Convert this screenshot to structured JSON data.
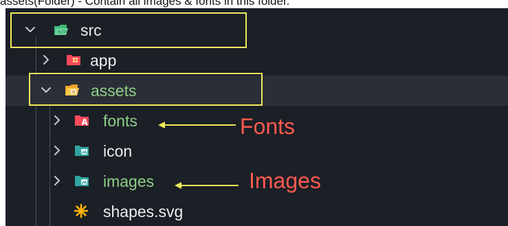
{
  "caption": "assets(Folder) - Contain all images & fonts in this folder.",
  "tree": {
    "src": {
      "label": "src",
      "icon": "src-folder-open-icon"
    },
    "app": {
      "label": "app",
      "icon": "app-folder-icon"
    },
    "assets": {
      "label": "assets",
      "icon": "assets-folder-open-icon"
    },
    "fonts": {
      "label": "fonts",
      "icon": "fonts-folder-icon"
    },
    "icon": {
      "label": "icon",
      "icon": "image-folder-icon"
    },
    "images": {
      "label": "images",
      "icon": "image-folder-icon"
    },
    "shapes": {
      "label": "shapes.svg",
      "icon": "svg-file-icon"
    }
  },
  "annotations": {
    "fonts": "Fonts",
    "images": "Images"
  },
  "colors": {
    "background": "#1b1f26",
    "selected_row": "#2a2f37",
    "highlight": "#f2e85c",
    "annotation": "#ff5a4e",
    "folder_label": "#8fcf88"
  }
}
